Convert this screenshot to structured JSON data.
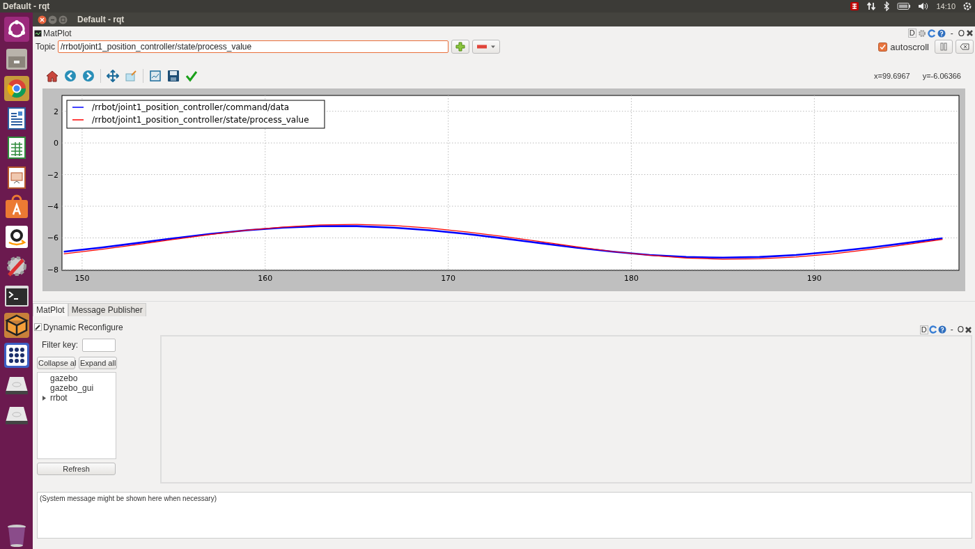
{
  "top_bar": {
    "title": "Default - rqt",
    "clock": "14:10"
  },
  "window": {
    "title": "Default - rqt"
  },
  "matplot": {
    "title": "MatPlot",
    "dock_letter": "D",
    "dock_controls": [
      "-",
      "O"
    ],
    "topic_label": "Topic",
    "topic_value": "/rrbot/joint1_position_controller/state/process_value",
    "autoscroll": {
      "label": "autoscroll",
      "checked": true
    },
    "coords": [
      "x=99.6967",
      "y=-6.06366"
    ],
    "chart_data": {
      "type": "line",
      "x": [
        149,
        151,
        153,
        155,
        157,
        159,
        161,
        163,
        165,
        167,
        169,
        171,
        173,
        175,
        177,
        179,
        181,
        183,
        185,
        187,
        189,
        191,
        193,
        195,
        197
      ],
      "series": [
        {
          "name": "/rrbot/joint1_position_controller/command/data",
          "color": "#0000ff",
          "values": [
            -6.87,
            -6.62,
            -6.33,
            -6.03,
            -5.75,
            -5.52,
            -5.35,
            -5.26,
            -5.26,
            -5.35,
            -5.52,
            -5.75,
            -6.03,
            -6.33,
            -6.62,
            -6.87,
            -7.08,
            -7.21,
            -7.25,
            -7.21,
            -7.08,
            -6.87,
            -6.62,
            -6.33,
            -6.03
          ]
        },
        {
          "name": "/rrbot/joint1_position_controller/state/process_value",
          "color": "#ff0000",
          "values": [
            -7.01,
            -6.74,
            -6.43,
            -6.1,
            -5.79,
            -5.51,
            -5.31,
            -5.18,
            -5.15,
            -5.22,
            -5.38,
            -5.62,
            -5.91,
            -6.23,
            -6.56,
            -6.86,
            -7.1,
            -7.27,
            -7.35,
            -7.32,
            -7.21,
            -7.01,
            -6.74,
            -6.43,
            -6.1
          ]
        }
      ],
      "grid": true,
      "legend": true,
      "xlim": [
        148.9,
        197.9
      ],
      "ylim": [
        -8.05,
        3
      ],
      "xticks": [
        150,
        160,
        170,
        180,
        190
      ],
      "yticks": [
        2,
        0,
        {
          "value": -2,
          "label": "−2"
        },
        {
          "value": -4,
          "label": "−4"
        },
        {
          "value": -6,
          "label": "−6"
        },
        {
          "value": -8,
          "label": "−8"
        }
      ]
    }
  },
  "tabs": [
    {
      "label": "MatPlot",
      "selected": true
    },
    {
      "label": "Message Publisher",
      "selected": false
    }
  ],
  "reconfigure": {
    "title": "Dynamic Reconfigure",
    "dock_letter": "D",
    "dock_controls": [
      "-",
      "O"
    ],
    "filter_label": "Filter key:",
    "collapse_button": "Collapse al",
    "expand_button": "Expand all",
    "tree": [
      {
        "label": "gazebo",
        "kind": "leaf"
      },
      {
        "label": "gazebo_gui",
        "kind": "leaf"
      },
      {
        "label": "rrbot",
        "kind": "group",
        "expanded": false
      }
    ],
    "refresh_button": "Refresh"
  },
  "system_message": "(System message might be shown here when necessary)"
}
